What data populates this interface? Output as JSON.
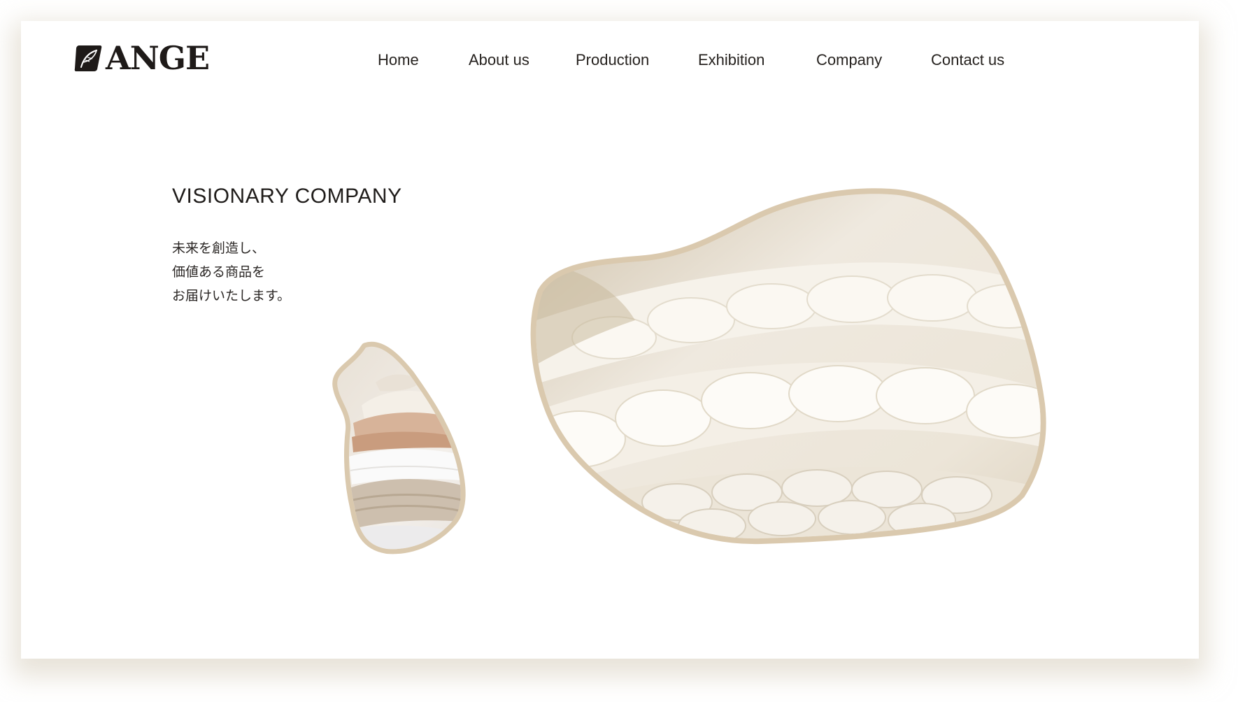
{
  "brand": {
    "name": "ANGE",
    "logo_icon": "feather-icon",
    "text_color": "#1e1a18"
  },
  "nav": {
    "items": [
      {
        "label": "Home"
      },
      {
        "label": "About us"
      },
      {
        "label": "Production"
      },
      {
        "label": "Exhibition"
      },
      {
        "label": "Company"
      },
      {
        "label": "Contact us"
      }
    ]
  },
  "hero": {
    "heading": "VISIONARY COMPANY",
    "lines": [
      "未来を創造し、",
      "価値ある商品を",
      "お届けいたします。"
    ]
  },
  "images": {
    "small": "folded knit sweaters stacked in an organic drop-shaped frame",
    "large": "close-up of cream chunky knit wool in an organic blob-shaped frame"
  },
  "colors": {
    "page_background": "#ffffff",
    "card_shadow": "#d6ccba",
    "wool_cream": "#efe9df",
    "frame_beige": "#d9c7ac",
    "text_dark": "#1f1c1a"
  }
}
